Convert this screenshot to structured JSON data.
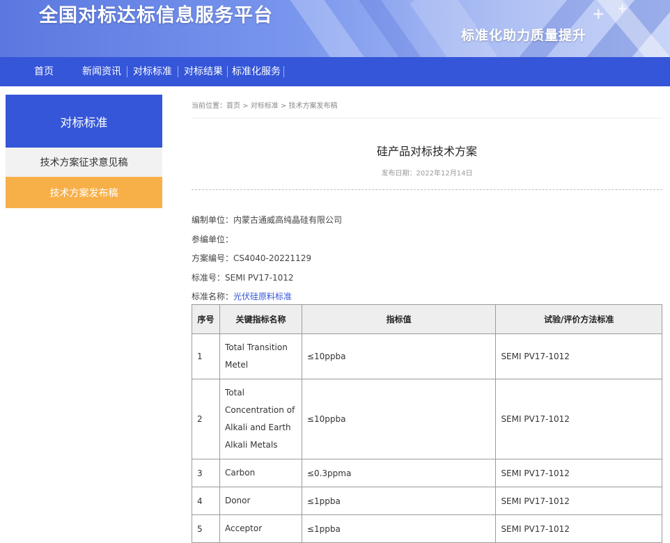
{
  "banner": {
    "title": "全国对标达标信息服务平台",
    "slogan": "标准化助力质量提升"
  },
  "nav": {
    "items": [
      "首页",
      "新闻资讯",
      "对标标准",
      "对标结果",
      "标准化服务"
    ]
  },
  "sidebar": {
    "heading": "对标标准",
    "items": [
      {
        "label": "技术方案征求意见稿",
        "active": false
      },
      {
        "label": "技术方案发布稿",
        "active": true
      }
    ]
  },
  "breadcrumb": "当前位置：首页 > 对标标准 > 技术方案发布稿",
  "article": {
    "title": "硅产品对标技术方案",
    "date": "发布日期：2022年12月14日"
  },
  "meta": {
    "compiler_label": "编制单位：",
    "compiler": "内蒙古通威高纯晶硅有限公司",
    "co_compiler_label": "参编单位：",
    "co_compiler": "",
    "plan_no_label": "方案编号：",
    "plan_no": "CS4040-20221129",
    "standard_no_label": "标准号：",
    "standard_no": "SEMI PV17-1012",
    "standard_name_label": "标准名称：",
    "standard_name": "光伏硅原料标准"
  },
  "table": {
    "headers": [
      "序号",
      "关键指标名称",
      "指标值",
      "试验/评价方法标准"
    ],
    "rows": [
      {
        "no": "1",
        "name_lines": [
          "Total Transition",
          "Metel"
        ],
        "value": "≤10ppba",
        "method": "SEMI PV17-1012"
      },
      {
        "no": "2",
        "name_lines": [
          "Total",
          "Concentration of",
          "Alkali and Earth",
          "Alkali Metals"
        ],
        "value": "≤10ppba",
        "method": "SEMI PV17-1012"
      },
      {
        "no": "3",
        "name_lines": [
          "Carbon"
        ],
        "value": "≤0.3ppma",
        "method": "SEMI PV17-1012"
      },
      {
        "no": "4",
        "name_lines": [
          "Donor"
        ],
        "value": "≤1ppba",
        "method": "SEMI PV17-1012"
      },
      {
        "no": "5",
        "name_lines": [
          "Acceptor"
        ],
        "value": "≤1ppba",
        "method": "SEMI PV17-1012"
      }
    ]
  },
  "colors": {
    "primary": "#3556d8",
    "accent": "#f7b048",
    "link": "#3556d8"
  }
}
